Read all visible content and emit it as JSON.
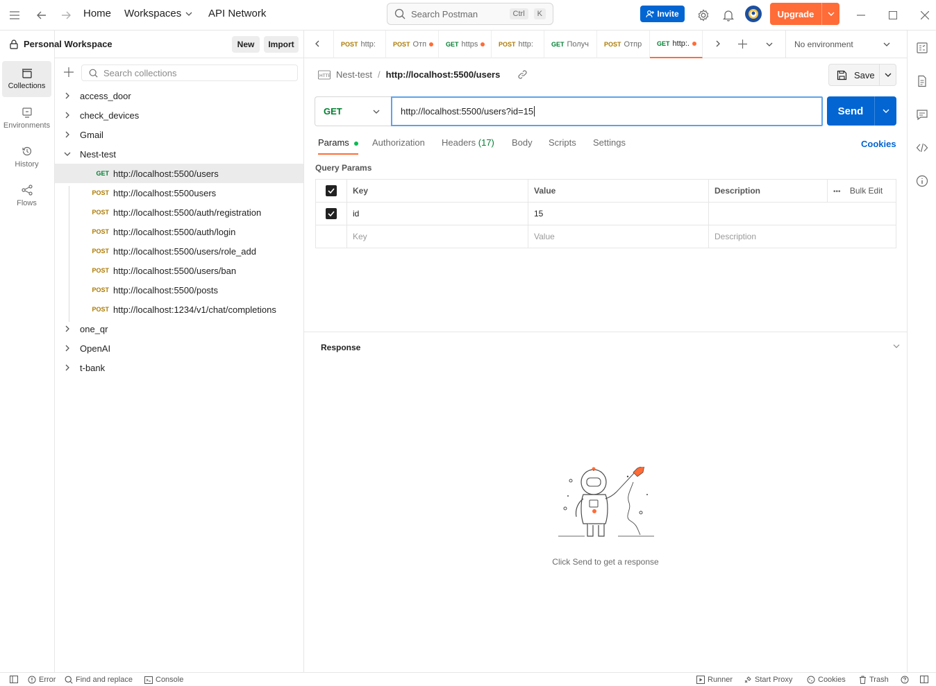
{
  "topbar": {
    "home": "Home",
    "workspaces": "Workspaces",
    "api_network": "API Network",
    "search_placeholder": "Search Postman",
    "shortcut_ctrl": "Ctrl",
    "shortcut_k": "K",
    "invite": "Invite",
    "upgrade": "Upgrade"
  },
  "rail": {
    "collections": "Collections",
    "environments": "Environments",
    "history": "History",
    "flows": "Flows"
  },
  "sidebar": {
    "workspace_title": "Personal Workspace",
    "new_btn": "New",
    "import_btn": "Import",
    "search_placeholder": "Search collections",
    "collections": [
      "access_door",
      "check_devices",
      "Gmail",
      "Nest-test",
      "one_qr",
      "OpenAI",
      "t-bank"
    ],
    "requests": [
      {
        "method": "GET",
        "url": "http://localhost:5500/users"
      },
      {
        "method": "POST",
        "url": "http://localhost:5500users"
      },
      {
        "method": "POST",
        "url": "http://localhost:5500/auth/registration"
      },
      {
        "method": "POST",
        "url": "http://localhost:5500/auth/login"
      },
      {
        "method": "POST",
        "url": "http://localhost:5500/users/role_add"
      },
      {
        "method": "POST",
        "url": "http://localhost:5500/users/ban"
      },
      {
        "method": "POST",
        "url": "http://localhost:5500/posts"
      },
      {
        "method": "POST",
        "url": "http://localhost:1234/v1/chat/completions"
      }
    ]
  },
  "tabs": [
    {
      "method": "POST",
      "label": "http:"
    },
    {
      "method": "POST",
      "label": "Отп"
    },
    {
      "method": "GET",
      "label": "https"
    },
    {
      "method": "POST",
      "label": "http:"
    },
    {
      "method": "GET",
      "label": "Получ"
    },
    {
      "method": "POST",
      "label": "Отпр"
    },
    {
      "method": "GET",
      "label": "http:."
    }
  ],
  "environment": "No environment",
  "request": {
    "collection": "Nest-test",
    "separator": "/",
    "name": "http://localhost:5500/users",
    "save": "Save",
    "method": "GET",
    "url": "http://localhost:5500/users?id=15",
    "send": "Send"
  },
  "subtabs": {
    "params": "Params",
    "authorization": "Authorization",
    "headers": "Headers",
    "headers_count": "(17)",
    "body": "Body",
    "scripts": "Scripts",
    "settings": "Settings",
    "cookies": "Cookies"
  },
  "params": {
    "title": "Query Params",
    "col_key": "Key",
    "col_value": "Value",
    "col_description": "Description",
    "bulk_edit": "Bulk Edit",
    "row_key": "id",
    "row_value": "15",
    "ph_key": "Key",
    "ph_value": "Value",
    "ph_description": "Description"
  },
  "response": {
    "title": "Response",
    "hint": "Click Send to get a response"
  },
  "footer": {
    "error": "Error",
    "find_replace": "Find and replace",
    "console": "Console",
    "runner": "Runner",
    "start_proxy": "Start Proxy",
    "cookies": "Cookies",
    "trash": "Trash"
  },
  "colors": {
    "accent": "#ff6c37",
    "primary": "#0265d2",
    "get": "#007f31",
    "post": "#ad7a03"
  }
}
